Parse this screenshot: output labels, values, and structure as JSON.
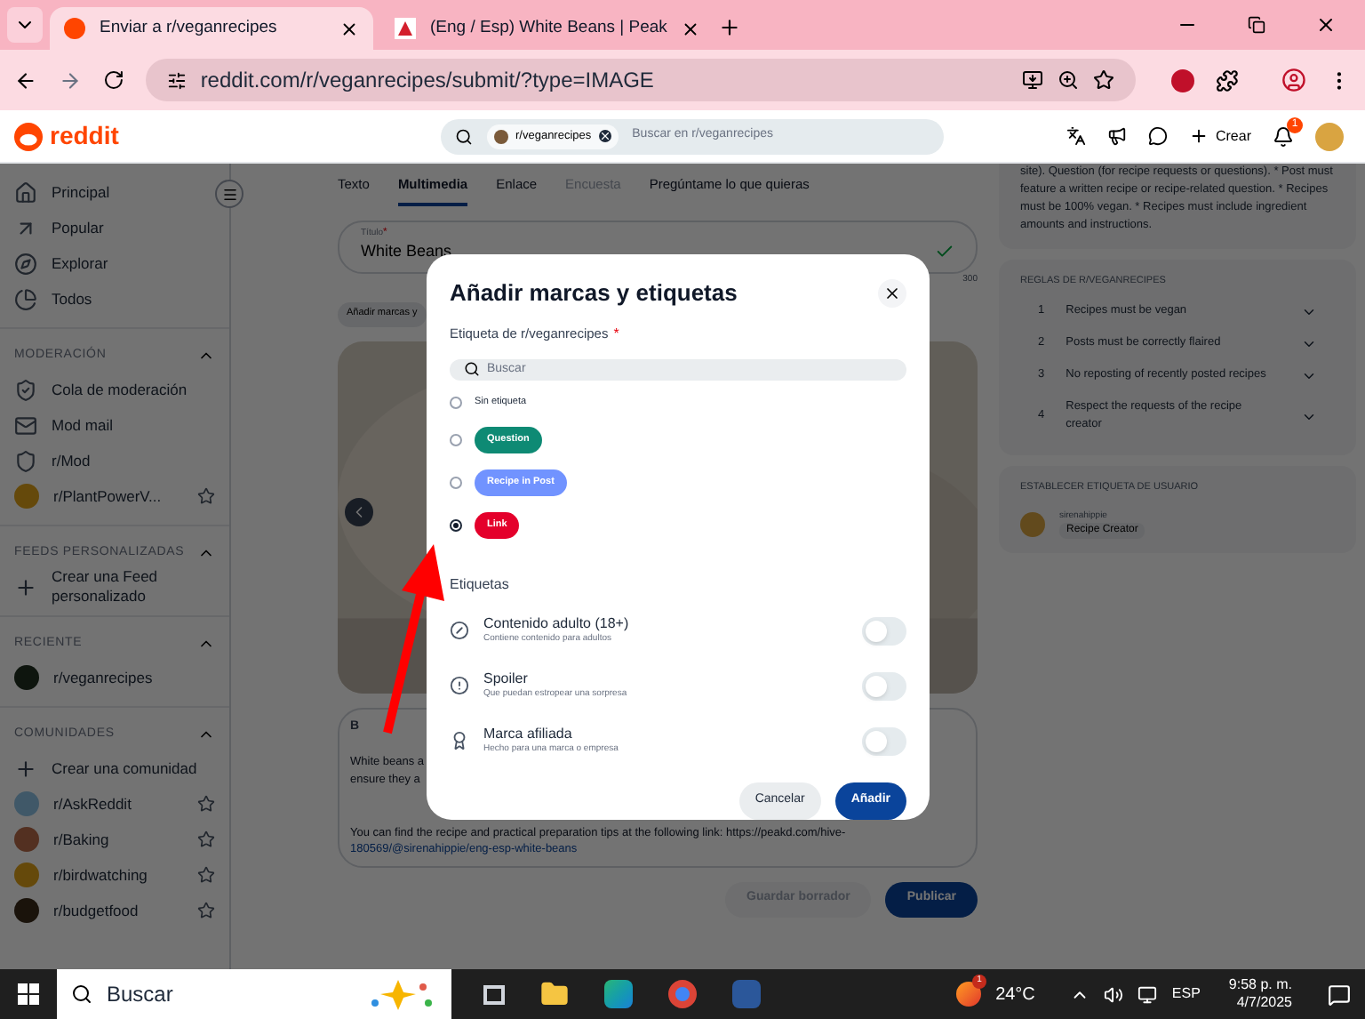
{
  "browser": {
    "tabs": [
      {
        "title": "Enviar a r/veganrecipes",
        "selected": true
      },
      {
        "title": "(Eng / Esp) White Beans | Peak",
        "selected": false
      }
    ],
    "url": "reddit.com/r/veganrecipes/submit/?type=IMAGE"
  },
  "header": {
    "logo": "reddit",
    "search_chip": "r/veganrecipes",
    "search_placeholder": "Buscar en r/veganrecipes",
    "create": "Crear",
    "notification_count": "1"
  },
  "sidebar": {
    "nav": [
      {
        "label": "Principal",
        "kind": "home"
      },
      {
        "label": "Popular",
        "kind": "popular"
      },
      {
        "label": "Explorar",
        "kind": "explore"
      },
      {
        "label": "Todos",
        "kind": "all"
      }
    ],
    "sections": [
      {
        "title": "MODERACIÓN",
        "expanded": true,
        "items": [
          {
            "label": "Cola de moderación",
            "kind": "queue"
          },
          {
            "label": "Mod mail",
            "kind": "mail"
          },
          {
            "label": "r/Mod",
            "kind": "mod"
          },
          {
            "label": "r/PlantPowerV...",
            "kind": "community"
          }
        ]
      },
      {
        "title": "FEEDS PERSONALIZADAS",
        "expanded": true,
        "items": [
          {
            "label": "Crear una Feed personalizado",
            "kind": "add"
          }
        ]
      },
      {
        "title": "RECIENTE",
        "expanded": true,
        "items": [
          {
            "label": "r/veganrecipes",
            "kind": "recent"
          }
        ]
      },
      {
        "title": "COMUNIDADES",
        "expanded": true,
        "items": [
          {
            "label": "Crear una comunidad",
            "kind": "add"
          },
          {
            "label": "r/AskReddit",
            "kind": "community"
          },
          {
            "label": "r/Baking",
            "kind": "community"
          },
          {
            "label": "r/birdwatching",
            "kind": "community"
          },
          {
            "label": "r/budgetfood",
            "kind": "community"
          }
        ]
      }
    ]
  },
  "post": {
    "tabs": [
      {
        "label": "Texto",
        "selected": false,
        "disabled": false
      },
      {
        "label": "Multimedia",
        "selected": true,
        "disabled": false
      },
      {
        "label": "Enlace",
        "selected": false,
        "disabled": false
      },
      {
        "label": "Encuesta",
        "selected": false,
        "disabled": true
      },
      {
        "label": "Pregúntame lo que quieras",
        "selected": false,
        "disabled": false
      }
    ],
    "title_label": "Título",
    "title_required_mark": "*",
    "title_value": "White Beans",
    "title_counter": "300",
    "tags_chip": "Añadir marcas y",
    "editor_bold": "B",
    "body_lines": [
      "White beans a",
      "ensure they a"
    ],
    "link_line": "You can find the recipe and practical preparation tips at the following link: https://peakd.com/hive-",
    "link_url": "180569/@sirenahippie/eng-esp-white-beans",
    "buttons": [
      {
        "label": "Guardar borrador",
        "disabled": true
      },
      {
        "label": "Publicar",
        "disabled": false
      }
    ]
  },
  "right": {
    "about": "site). Question (for recipe requests or questions). * Post must feature a written recipe or recipe-related question. * Recipes must be 100% vegan. * Recipes must include ingredient amounts and instructions.",
    "rules_title": "REGLAS DE R/VEGANRECIPES",
    "rules": [
      {
        "number": "1",
        "text": "Recipes must be vegan",
        "expanded": false
      },
      {
        "number": "2",
        "text": "Posts must be correctly flaired",
        "expanded": false
      },
      {
        "number": "3",
        "text": "No reposting of recently posted recipes",
        "expanded": false
      },
      {
        "number": "4",
        "text": "Respect the requests of the recipe creator",
        "expanded": false
      }
    ],
    "user_flair_title": "ESTABLECER ETIQUETA DE USUARIO",
    "username": "sirenahippie",
    "user_flair": "Recipe Creator"
  },
  "modal": {
    "title": "Añadir marcas y etiquetas",
    "flair_label": "Etiqueta de r/veganrecipes",
    "flair_required_mark": "*",
    "search_placeholder": "Buscar",
    "flairs": [
      {
        "label": "Sin etiqueta",
        "kind": "plain",
        "selected": false
      },
      {
        "label": "Question",
        "kind": "pill",
        "color": "#0e8a74",
        "selected": false
      },
      {
        "label": "Recipe in Post",
        "kind": "pill",
        "color": "#7193ff",
        "selected": false
      },
      {
        "label": "Link",
        "kind": "pill",
        "color": "#e4002b",
        "selected": true
      }
    ],
    "tags_title": "Etiquetas",
    "tags": [
      {
        "title": "Contenido adulto (18+)",
        "description": "Contiene contenido para adultos",
        "kind": "adult",
        "on": false
      },
      {
        "title": "Spoiler",
        "description": "Que puedan estropear una sorpresa",
        "kind": "spoiler",
        "on": false
      },
      {
        "title": "Marca afiliada",
        "description": "Hecho para una marca o empresa",
        "kind": "brand",
        "on": false
      }
    ],
    "cancel": "Cancelar",
    "confirm": "Añadir"
  },
  "taskbar": {
    "search": "Buscar",
    "weather_badge": "1",
    "temperature": "24°C",
    "language": "ESP",
    "time": "9:58 p. m.",
    "date": "4/7/2025"
  }
}
